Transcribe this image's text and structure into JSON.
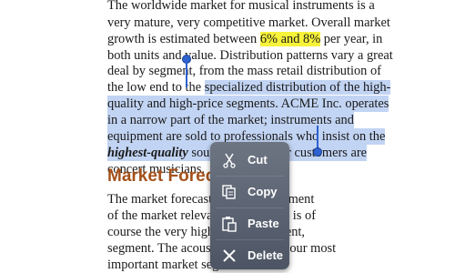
{
  "document": {
    "line1": "The worldwide market for musical instruments is a",
    "line2": "very mature, very competitive market. Overall market",
    "line3_pre": "growth is estimated between ",
    "line3_hl": "6% and 8%",
    "line3_post": " per year, in",
    "line4": "both units and value. Distribution patterns vary a great",
    "line5": "deal by segment, from the mass retail distribution of",
    "line6_pre": "the low end to the ",
    "line6_sel": "specialized distribution of the high-",
    "line7": "quality and high-price segments. ACME Inc. operates",
    "line8": "in a narrow part of the market; instruments and",
    "line9": "equipment are sold to professionals who insist on the",
    "line10_bold": "highest-quality",
    "line10_sel": " sound. Most of our customers are",
    "line11": "concert musicians.",
    "heading": "Market Forecast",
    "p2_line1": "The market forecast shows the segment",
    "p2_line2": "of the market relevant to us, which is of",
    "p2_line3": "course the very high-quality segment,",
    "p2_line4": "segment. The acoustic instrument, our most",
    "p2_line5": "important market segment ..."
  },
  "context_menu": {
    "items": [
      {
        "label": "Cut",
        "icon": "scissors-icon"
      },
      {
        "label": "Copy",
        "icon": "copy-icon"
      },
      {
        "label": "Paste",
        "icon": "paste-icon"
      },
      {
        "label": "Delete",
        "icon": "delete-icon"
      }
    ]
  },
  "colors": {
    "selection": "#c2d4f3",
    "highlight": "#f7f23a",
    "heading": "#a4511a",
    "handle": "#2d62d0",
    "menu_bg": "#5a6272"
  }
}
